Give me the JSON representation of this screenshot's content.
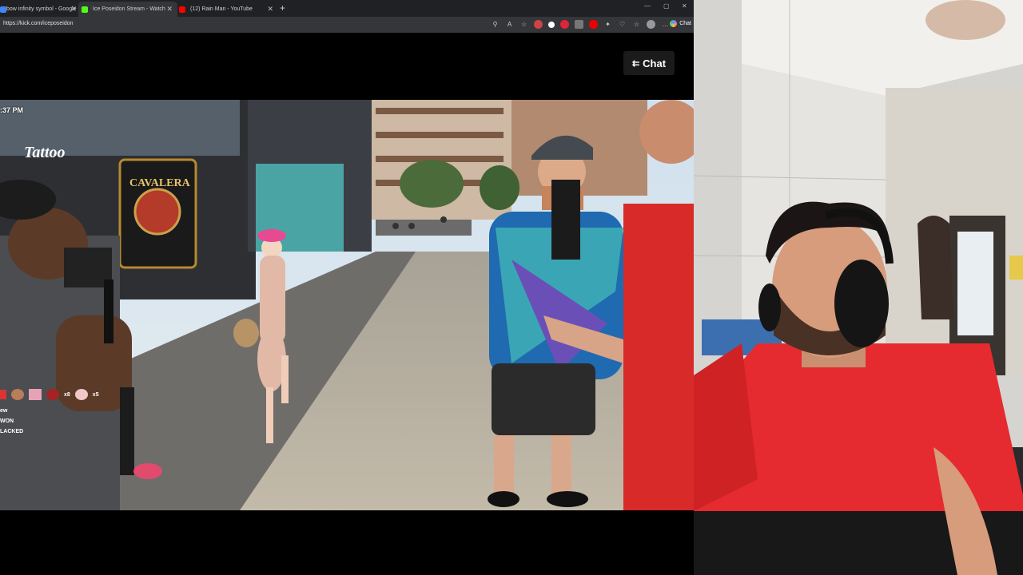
{
  "tabs": [
    {
      "title": "bow infinity symbol - Google",
      "icon_color": "#4285f4"
    },
    {
      "title": "Ice Poseidon Stream - Watch",
      "icon_color": "#53fc18"
    },
    {
      "title": "(12) Rain Man - YouTube",
      "icon_color": "#ff0000"
    }
  ],
  "address": {
    "url": "https://kick.com/iceposeidon"
  },
  "toolbar": {
    "copilot_label": "Chat"
  },
  "player": {
    "chat_label": "Chat",
    "time_label": ":37 PM"
  },
  "overlay": {
    "lines": [
      "ew",
      "WON",
      "LACKED"
    ],
    "badge_counts": [
      "x8",
      "x5"
    ]
  },
  "signage": {
    "shop1": "Tattoo",
    "shop2": "CAVALERA"
  },
  "colors": {
    "kick_green": "#53fc18",
    "shirt_red": "#e02a2a",
    "tab_bar": "#202124",
    "address_bar": "#35363a"
  }
}
